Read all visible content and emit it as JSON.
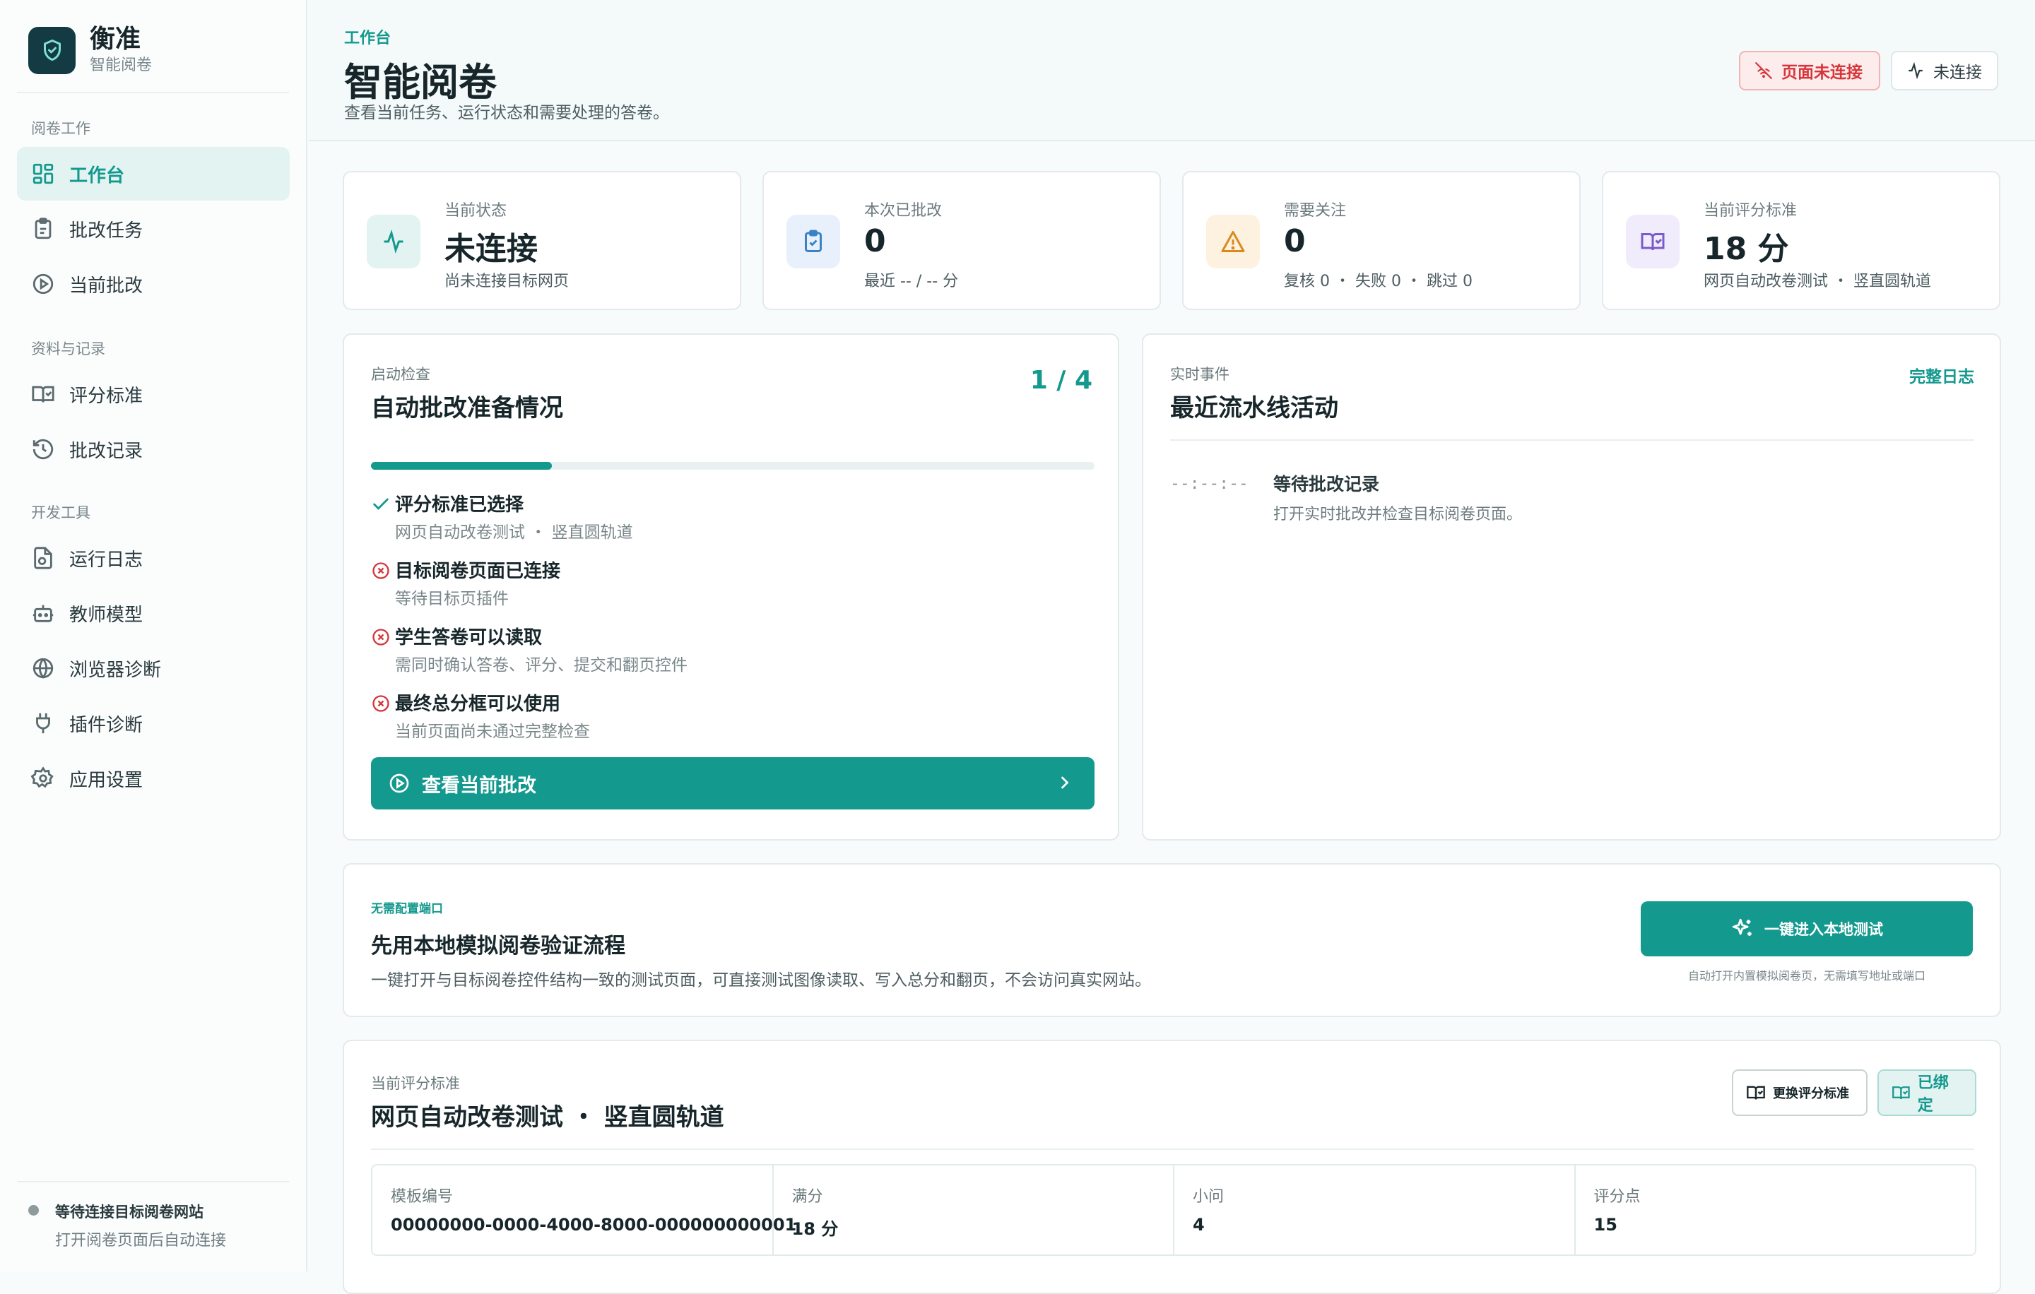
{
  "brand": {
    "name": "衡准",
    "subtitle": "智能阅卷"
  },
  "sidebar": {
    "sections": [
      "阅卷工作",
      "资料与记录",
      "开发工具"
    ],
    "items": [
      {
        "label": "工作台",
        "icon": "dashboard-icon",
        "active": true
      },
      {
        "label": "批改任务",
        "icon": "clipboard-icon"
      },
      {
        "label": "当前批改",
        "icon": "play-circle-icon"
      },
      {
        "label": "评分标准",
        "icon": "book-check-icon"
      },
      {
        "label": "批改记录",
        "icon": "history-icon"
      },
      {
        "label": "运行日志",
        "icon": "file-log-icon"
      },
      {
        "label": "教师模型",
        "icon": "bot-icon"
      },
      {
        "label": "浏览器诊断",
        "icon": "globe-icon"
      },
      {
        "label": "插件诊断",
        "icon": "plug-icon"
      },
      {
        "label": "应用设置",
        "icon": "gear-icon"
      }
    ],
    "footer": {
      "status": "等待连接目标阅卷网站",
      "hint": "打开阅卷页面后自动连接"
    }
  },
  "header": {
    "eyebrow": "工作台",
    "title": "智能阅卷",
    "subtitle": "查看当前任务、运行状态和需要处理的答卷。",
    "page_status_label": "页面未连接",
    "conn_status_label": "未连接"
  },
  "stats": [
    {
      "label": "当前状态",
      "value": "未连接",
      "sub": "尚未连接目标网页",
      "icon": "activity-icon",
      "color": "#14998e",
      "bg": "#e3f3f1"
    },
    {
      "label": "本次已批改",
      "value": "0",
      "sub": "最近 -- / -- 分",
      "icon": "clipboard-check-icon",
      "color": "#3b82c4",
      "bg": "#e8f1fb"
    },
    {
      "label": "需要关注",
      "value": "0",
      "sub": "复核 0 ・ 失败 0 ・ 跳过 0",
      "icon": "warning-icon",
      "color": "#d98a1c",
      "bg": "#fdf2e0"
    },
    {
      "label": "当前评分标准",
      "value": "18 分",
      "sub": "网页自动改卷测试 ・ 竖直圆轨道",
      "icon": "book-check-icon",
      "color": "#7b5bc9",
      "bg": "#f1ecfb"
    }
  ],
  "readiness": {
    "eyebrow": "启动检查",
    "title": "自动批改准备情况",
    "counter": "1 / 4",
    "progress": 0.25,
    "checks": [
      {
        "title": "评分标准已选择",
        "detail": "网页自动改卷测试 ・ 竖直圆轨道",
        "ok": true
      },
      {
        "title": "目标阅卷页面已连接",
        "detail": "等待目标页插件",
        "ok": false
      },
      {
        "title": "学生答卷可以读取",
        "detail": "需同时确认答卷、评分、提交和翻页控件",
        "ok": false
      },
      {
        "title": "最终总分框可以使用",
        "detail": "当前页面尚未通过完整检查",
        "ok": false
      }
    ],
    "button_label": "查看当前批改"
  },
  "events": {
    "eyebrow": "实时事件",
    "title": "最近流水线活动",
    "link_label": "完整日志",
    "items": [
      {
        "time": "--:--:--",
        "title": "等待批改记录",
        "detail": "打开实时批改并检查目标阅卷页面。"
      }
    ]
  },
  "local_test": {
    "eyebrow": "无需配置端口",
    "title": "先用本地模拟阅卷验证流程",
    "desc": "一键打开与目标阅卷控件结构一致的测试页面，可直接测试图像读取、写入总分和翻页，不会访问真实网站。",
    "button_label": "一键进入本地测试",
    "button_note": "自动打开内置模拟阅卷页，无需填写地址或端口"
  },
  "rubric": {
    "eyebrow": "当前评分标准",
    "title": "网页自动改卷测试 ・ 竖直圆轨道",
    "change_label": "更换评分标准",
    "bound_label": "已绑定",
    "fields": [
      {
        "label": "模板编号",
        "value": "00000000-0000-4000-8000-000000000001"
      },
      {
        "label": "满分",
        "value": "18 分"
      },
      {
        "label": "小问",
        "value": "4"
      },
      {
        "label": "评分点",
        "value": "15"
      }
    ]
  }
}
